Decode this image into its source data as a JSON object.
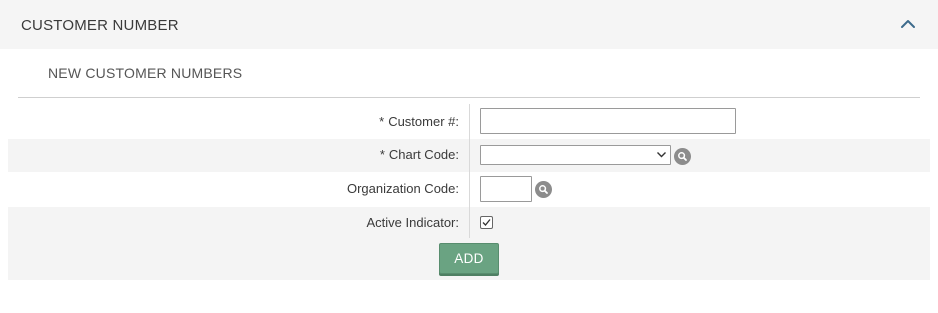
{
  "section": {
    "title": "CUSTOMER NUMBER",
    "collapse_icon": "chevron-up-icon"
  },
  "subsection": {
    "title": "NEW CUSTOMER NUMBERS"
  },
  "form": {
    "customer_number": {
      "required_marker": "*",
      "label": "Customer #:",
      "value": ""
    },
    "chart_code": {
      "required_marker": "*",
      "label": "Chart Code:",
      "selected_value": "",
      "lookup_icon": "search-icon"
    },
    "organization_code": {
      "label": "Organization Code:",
      "value": "",
      "lookup_icon": "search-icon"
    },
    "active_indicator": {
      "label": "Active Indicator:",
      "checked": true
    },
    "add_label": "ADD"
  },
  "colors": {
    "header_bg": "#f5f5f5",
    "shaded_row_bg": "#f4f4f4",
    "button_bg": "#6aa382",
    "icon_gray": "#8c8c8c"
  }
}
